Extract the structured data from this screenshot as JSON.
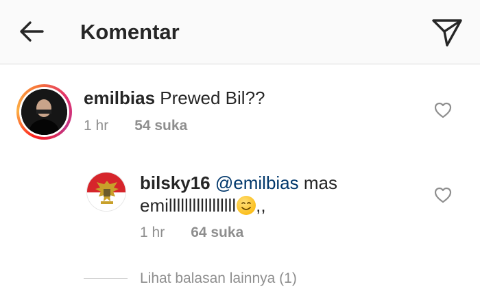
{
  "header": {
    "title": "Komentar"
  },
  "comments": [
    {
      "username": "emilbias",
      "text": "Prewed Bil??",
      "time": "1 hr",
      "likes": "54 suka"
    }
  ],
  "replies": [
    {
      "username": "bilsky16",
      "mention": "@emilbias",
      "text_line1": "mas",
      "text_line2": "emilllllllllllllllll",
      "text_suffix": ",,",
      "emoji": "smiling-face-emoji",
      "time": "1 hr",
      "likes": "64 suka"
    }
  ],
  "view_more": {
    "label": "Lihat balasan lainnya (1)"
  },
  "icons": {
    "back": "arrow-left-icon",
    "send": "paper-plane-icon",
    "like": "heart-outline-icon"
  },
  "colors": {
    "header_bg": "#fafafa",
    "text": "#262626",
    "muted": "#8e8e8e",
    "mention": "#00376b"
  }
}
